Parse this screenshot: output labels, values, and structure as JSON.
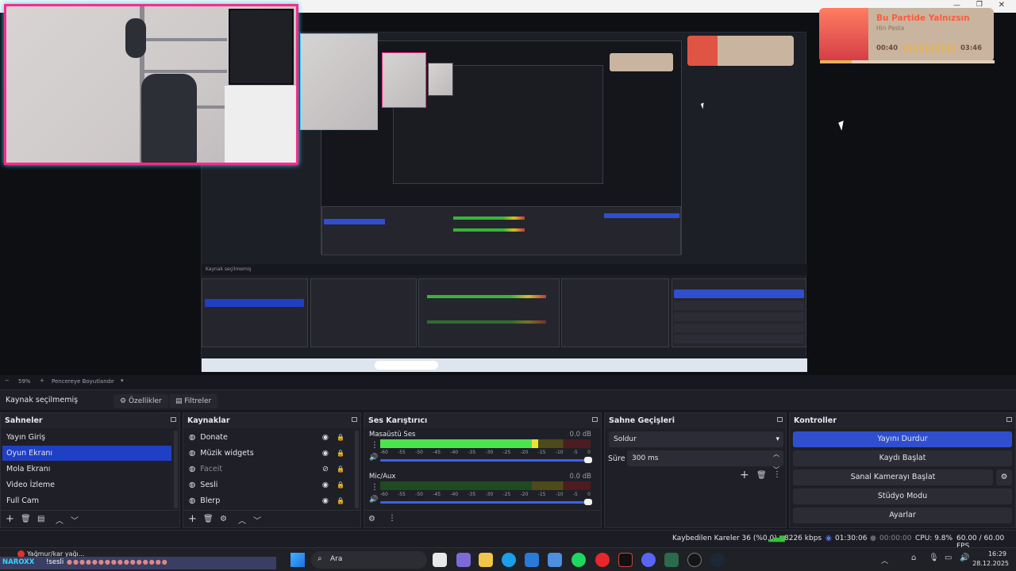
{
  "music_widget": {
    "song": "Bu Partide Yalnızsın",
    "artist": "Hin Pesta",
    "elapsed": "00:40",
    "duration": "03:46",
    "progress": 0.18,
    "accent": "#ff5a3c"
  },
  "preview": {
    "zoom": "59%",
    "resize_label": "Pencereye Boyutlandır"
  },
  "source_bar": {
    "status": "Kaynak seçilmemiş",
    "properties": "Özellikler",
    "filters": "Filtreler"
  },
  "scenes": {
    "title": "Sahneler",
    "items": [
      "Yayın Giriş",
      "Oyun Ekranı",
      "Mola Ekranı",
      "Video İzleme",
      "Full Cam"
    ],
    "selected": "Oyun Ekranı"
  },
  "sources": {
    "title": "Kaynaklar",
    "items": [
      {
        "label": "Donate",
        "icon": "globe-icon",
        "hidden": false
      },
      {
        "label": "Müzik widgets",
        "icon": "globe-icon",
        "hidden": false
      },
      {
        "label": "Faceit",
        "icon": "globe-icon",
        "hidden": true
      },
      {
        "label": "Sesli",
        "icon": "globe-icon",
        "hidden": false
      },
      {
        "label": "Blerp",
        "icon": "globe-icon",
        "hidden": false
      }
    ]
  },
  "mixer": {
    "title": "Ses Karıştırıcı",
    "ticks": [
      "-60",
      "-55",
      "-50",
      "-45",
      "-40",
      "-35",
      "-30",
      "-25",
      "-20",
      "-15",
      "-10",
      "-5",
      "0"
    ],
    "channels": [
      {
        "name": "Masaüstü Ses",
        "db": "0.0 dB",
        "level": 0.75
      },
      {
        "name": "Mic/Aux",
        "db": "0.0 dB",
        "level": 0.0
      }
    ]
  },
  "transitions": {
    "title": "Sahne Geçişleri",
    "selected": "Soldur",
    "duration_label": "Süre",
    "duration_value": "300 ms"
  },
  "controls": {
    "title": "Kontroller",
    "stop_stream": "Yayını Durdur",
    "start_record": "Kaydı Başlat",
    "virtual_cam": "Sanal Kamerayı Başlat",
    "studio_mode": "Stüdyo Modu",
    "settings": "Ayarlar"
  },
  "status": {
    "dropped": "Kaybedilen Kareler 36 (%0.0)",
    "bitrate": "8226 kbps",
    "stream_time": "01:30:06",
    "rec_time": "00:00:00",
    "cpu": "CPU: 9.8%",
    "fps": "60.00 / 60.00 FPS"
  },
  "taskbar": {
    "weather": "Yağmur/kar yağı...",
    "search": "Ara",
    "time": "16:29",
    "date": "28.12.2025",
    "chat_user": "NAROXX",
    "chat_text": "!sesli"
  }
}
